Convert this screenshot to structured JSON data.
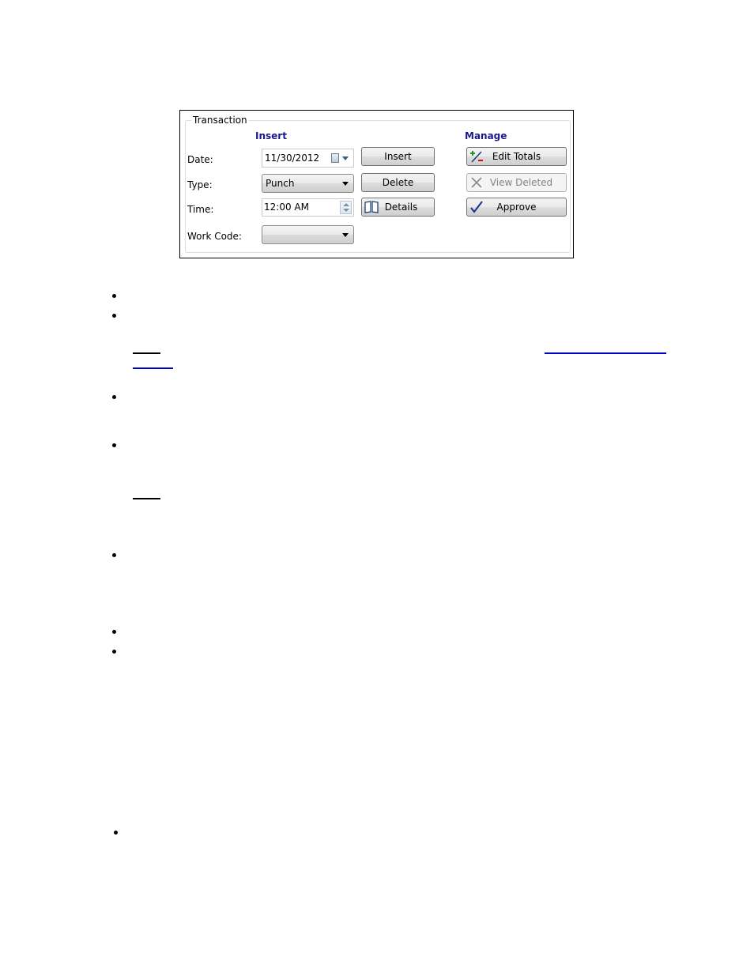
{
  "transaction": {
    "title": "Transaction",
    "insert_heading": "Insert",
    "manage_heading": "Manage",
    "date_label": "Date:",
    "type_label": "Type:",
    "time_label": "Time:",
    "workcode_label": "Work Code:",
    "date_value": "11/30/2012",
    "type_value": "Punch",
    "time_value": "12:00 AM",
    "workcode_value": "",
    "insert_button": "Insert",
    "delete_button": "Delete",
    "details_button": "Details",
    "edit_totals_button": "Edit Totals",
    "view_deleted_button": "View Deleted",
    "approve_button": "Approve",
    "heading_color": "#1a1a8c",
    "icons": {
      "calendar": "calendar-icon",
      "spinner": "spinner-icon",
      "details": "book-icon",
      "edit_totals": "plus-minus-icon",
      "view_deleted": "x-icon",
      "approve": "checkmark-icon"
    }
  },
  "document": {
    "link_color": "#0000cc"
  }
}
